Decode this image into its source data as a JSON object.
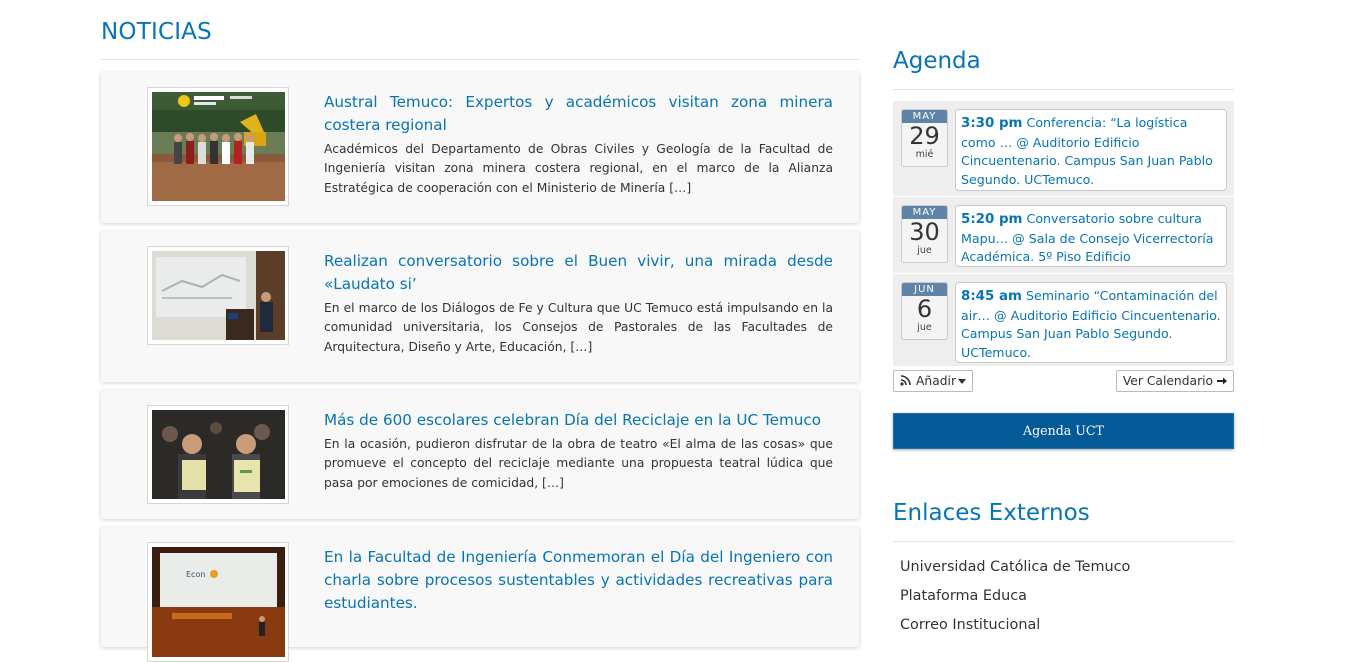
{
  "news": {
    "heading": "NOTICIAS",
    "items": [
      {
        "title": "Austral Temuco: Expertos y académicos visitan zona minera costera regional",
        "excerpt": "Académicos del Departamento de Obras Civiles y Geología de la Facultad de Ingeniería visitan zona minera costera regional, en el marco de la Alianza Estratégica de cooperación con el Ministerio de Minería […]",
        "image": "group-at-mining-site-photo"
      },
      {
        "title": "Realizan conversatorio sobre el Buen vivir, una mirada desde «Laudato si’",
        "excerpt": "En el marco de los Diálogos de Fe y Cultura que UC Temuco está impulsando en la comunidad universitaria, los Consejos de Pastorales de las Facultades de Arquitectura, Diseño y Arte, Educación, […]",
        "image": "speaker-at-podium-photo"
      },
      {
        "title": "Más de 600 escolares celebran Día del Reciclaje en la UC Temuco",
        "excerpt": "En la ocasión, pudieron disfrutar de la obra de teatro «El alma de las cosas» que promueve el concepto del reciclaje mediante una propuesta teatral lúdica que pasa por emociones de comicidad, […]",
        "image": "children-with-bags-photo"
      },
      {
        "title": "En la Facultad de Ingeniería Conmemoran el Día del Ingeniero con charla sobre procesos sustentables y actividades recreativas para estudiantes.",
        "excerpt": "",
        "image": "auditorium-stage-photo"
      }
    ]
  },
  "agenda": {
    "heading": "Agenda",
    "events": [
      {
        "month": "MAY",
        "day": "29",
        "weekday": "mié",
        "time": "3:30 pm",
        "text": "Conferencia: “La logística como … @ Auditorio Edificio Cincuentenario. Campus San Juan Pablo Segundo. UCTemuco."
      },
      {
        "month": "MAY",
        "day": "30",
        "weekday": "jue",
        "time": "5:20 pm",
        "text": "Conversatorio sobre cultura Mapu… @ Sala de Consejo Vicerrectoría Académica. 5º Piso Edificio Cincuentenario.."
      },
      {
        "month": "JUN",
        "day": "6",
        "weekday": "jue",
        "time": "8:45 am",
        "text": "Seminario “Contaminación del air… @ Auditorio Edificio Cincuentenario. Campus San Juan Pablo Segundo. UCTemuco."
      }
    ],
    "add_label": "Añadir",
    "calendar_label": "Ver Calendario",
    "uct_button": "Agenda UCT"
  },
  "external_links": {
    "heading": "Enlaces Externos",
    "items": [
      "Universidad Católica de Temuco",
      "Plataforma Educa",
      "Correo Institucional"
    ]
  },
  "colors": {
    "link_blue": "#0774b5",
    "button_blue": "#045a96",
    "badge_month": "#5f84a8"
  },
  "icons": {
    "add": "rss-icon",
    "calendar": "arrow-right-icon"
  }
}
